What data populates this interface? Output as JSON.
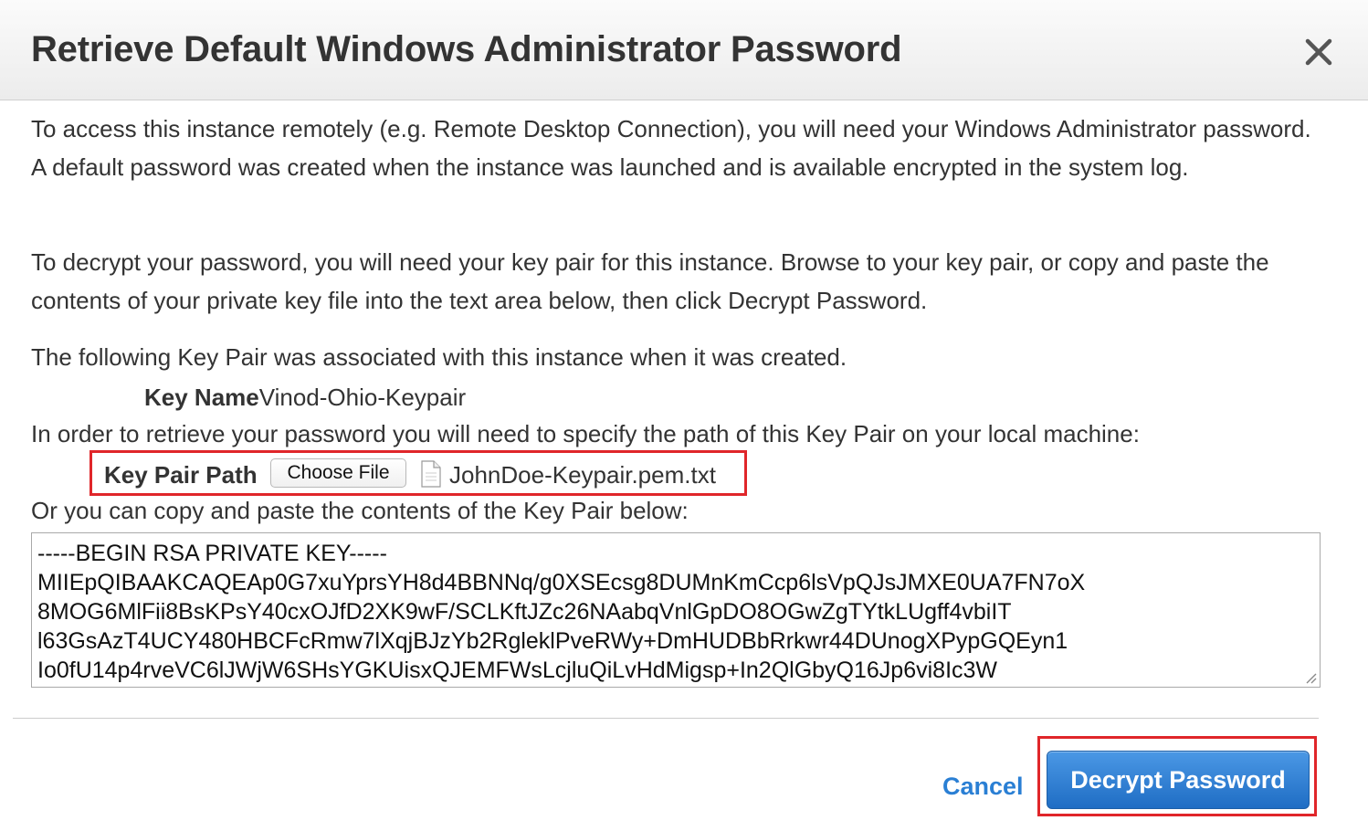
{
  "dialog": {
    "title": "Retrieve Default Windows Administrator Password",
    "close_icon": "close-icon"
  },
  "body": {
    "paragraph1": "To access this instance remotely (e.g. Remote Desktop Connection), you will need your Windows Administrator password. A default password was created when the instance was launched and is available encrypted in the system log.",
    "paragraph2": "To decrypt your password, you will need your key pair for this instance. Browse to your key pair, or copy and paste the contents of your private key file into the text area below, then click Decrypt Password.",
    "paragraph3": "The following Key Pair was associated with this instance when it was created.",
    "key_name_label": "Key Name",
    "key_name_value": "Vinod-Ohio-Keypair",
    "paragraph4": "In order to retrieve your password you will need to specify the path of this Key Pair on your local machine:",
    "key_pair_path_label": "Key Pair Path",
    "choose_file_label": "Choose File",
    "file_icon": "document-icon",
    "selected_file_name": "JohnDoe-Keypair.pem.txt",
    "paragraph5": "Or you can copy and paste the contents of the Key Pair below:",
    "key_contents": "-----BEGIN RSA PRIVATE KEY-----\nMIIEpQIBAAKCAQEAp0G7xuYprsYH8d4BBNNq/g0XSEcsg8DUMnKmCcp6lsVpQJsJMXE0UA7FN7oX\n8MOG6MlFii8BsKPsY40cxOJfD2XK9wF/SCLKftJZc26NAabqVnlGpDO8OGwZgTYtkLUgff4vbiIT\nl63GsAzT4UCY480HBCFcRmw7lXqjBJzYb2RgleklPveRWy+DmHUDBbRrkwr44DUnogXPypGQEyn1\nIo0fU14p4rveVC6lJWjW6SHsYGKUisxQJEMFWsLcjluQiLvHdMigsp+In2QlGbyQ16Jp6vi8Ic3W"
  },
  "footer": {
    "cancel_label": "Cancel",
    "decrypt_label": "Decrypt Password"
  },
  "colors": {
    "highlight": "#e0262a",
    "primary_button": "#2b7bd3",
    "link": "#2a7fd4"
  }
}
